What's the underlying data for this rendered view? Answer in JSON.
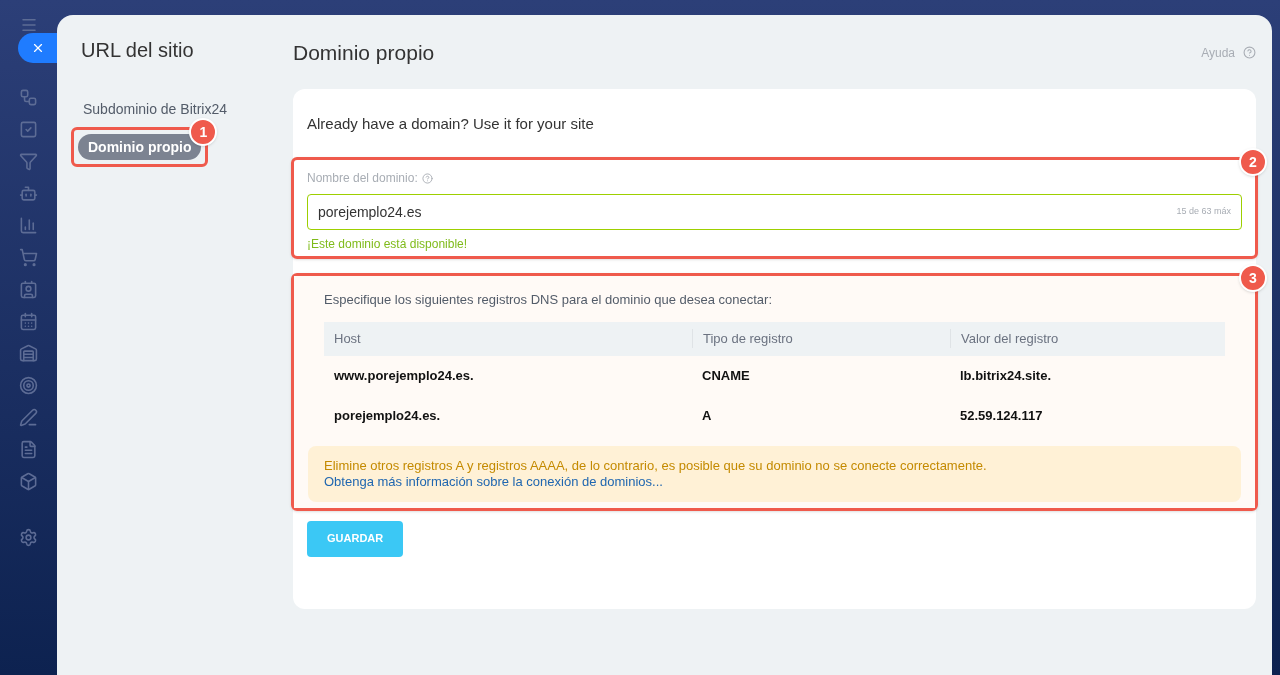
{
  "nav": {
    "title": "URL del sitio",
    "items": [
      {
        "label": "Subdominio de Bitrix24",
        "selected": false
      },
      {
        "label": "Dominio propio",
        "selected": true
      }
    ]
  },
  "page": {
    "title": "Dominio propio",
    "help": "Ayuda"
  },
  "intro": "Already have a domain? Use it for your site",
  "domain_field": {
    "label": "Nombre del dominio:",
    "value": "porejemplo24.es",
    "counter": "15 de 63 máx",
    "status": "¡Este dominio está disponible!",
    "valid": true
  },
  "dns": {
    "instructions": "Especifique los siguientes registros DNS para el dominio que desea conectar:",
    "columns": [
      "Host",
      "Tipo de registro",
      "Valor del registro"
    ],
    "rows": [
      [
        "www.porejemplo24.es.",
        "CNAME",
        "lb.bitrix24.site."
      ],
      [
        "porejemplo24.es.",
        "A",
        "52.59.124.117"
      ]
    ],
    "warning": "Elimine otros registros A y registros AAAA, de lo contrario, es posible que su dominio no se conecte correctamente.",
    "warning_link": "Obtenga más información sobre la conexión de dominios..."
  },
  "save_button": "GUARDAR",
  "callouts": [
    "1",
    "2",
    "3"
  ]
}
